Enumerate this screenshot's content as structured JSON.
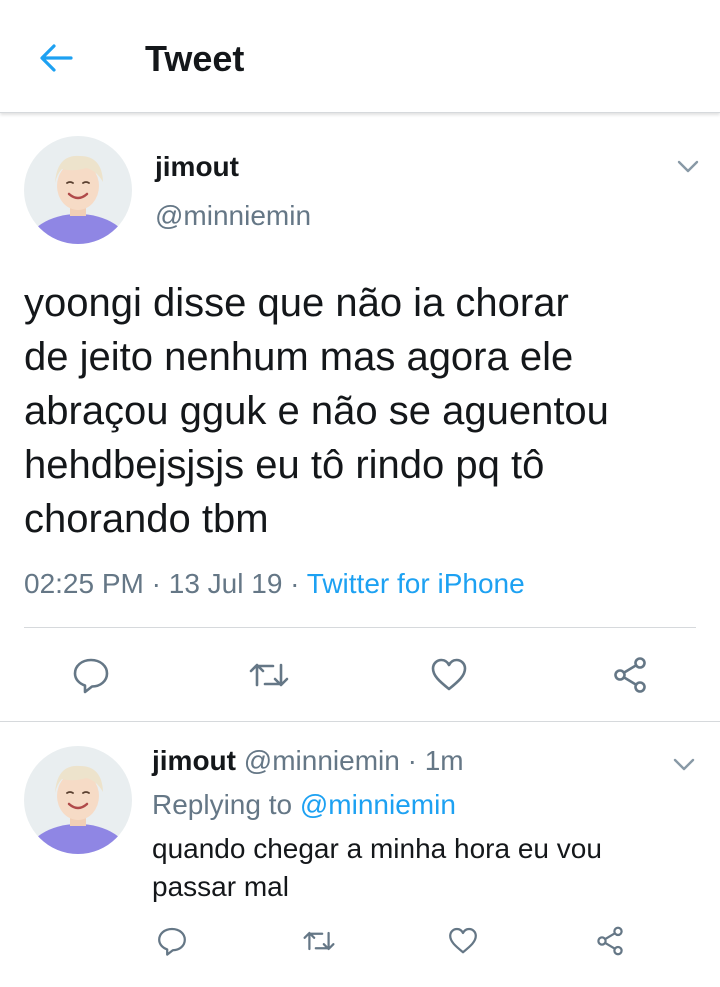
{
  "header": {
    "title": "Tweet",
    "back_icon": "arrow-left-icon",
    "accent_color": "#1da1f2"
  },
  "tweet": {
    "name": "jimout",
    "handle": "@minniemin",
    "text": "yoongi disse que não ia chorar\nde jeito nenhum mas agora ele\nabraçou gguk e não se aguentou\nhehdbejsjsjs eu tô rindo pq tô\nchorando tbm",
    "time": "02:25 PM",
    "separator_1": " · ",
    "date": "13 Jul 19",
    "separator_2": " · ",
    "source": "Twitter for iPhone",
    "actions": [
      "reply-icon",
      "retweet-icon",
      "like-icon",
      "share-icon"
    ]
  },
  "reply": {
    "name": "jimout",
    "handle": "@minniemin",
    "separator": " · ",
    "age": "1m",
    "replying_label": "Replying to ",
    "replying_to": "@minniemin",
    "text": "quando chegar a minha hora eu vou\npassar mal",
    "actions": [
      "reply-icon",
      "retweet-icon",
      "like-icon",
      "share-icon"
    ]
  }
}
